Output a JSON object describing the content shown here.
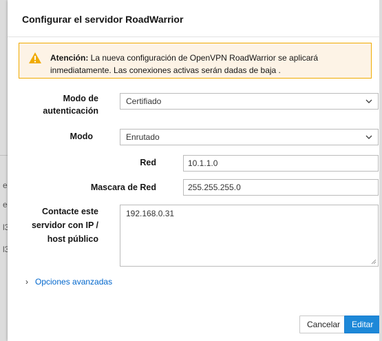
{
  "background": {
    "fragments": [
      "er",
      "er",
      "l3",
      "l3"
    ]
  },
  "dialog": {
    "title": "Configurar el servidor RoadWarrior",
    "alert": {
      "icon": "warning-icon",
      "strong": "Atención:",
      "text": " La nueva configuración de OpenVPN RoadWarrior se aplicará inmediatamente. Las conexiones activas serán dadas de baja ."
    },
    "auth_mode": {
      "label": "Modo de autenticación",
      "value": "Certifiado"
    },
    "mode": {
      "label": "Modo",
      "value": "Enrutado"
    },
    "network": {
      "label": "Red",
      "value": "10.1.1.0"
    },
    "netmask": {
      "label": "Mascara de Red",
      "value": "255.255.255.0"
    },
    "public_host": {
      "label": "Contacte este servidor con IP / host público",
      "value": "192.168.0.31"
    },
    "advanced": {
      "label": "Opciones avanzadas"
    },
    "buttons": {
      "cancel": "Cancelar",
      "edit": "Editar"
    }
  },
  "colors": {
    "primary": "#1d88d8",
    "link": "#0066cc",
    "warning_border": "#f0ab00",
    "warning_bg": "#fdf3e6"
  }
}
